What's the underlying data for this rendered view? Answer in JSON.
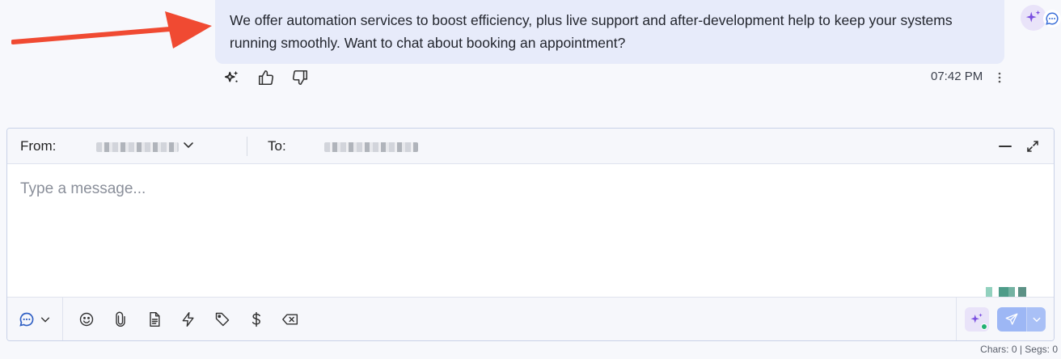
{
  "message": {
    "text": "We offer automation services to boost efficiency, plus live support and after-development help to keep your systems running smoothly. Want to chat about booking an appointment?",
    "timestamp": "07:42 PM"
  },
  "icons": {
    "arrow": "red-arrow-icon",
    "ai": "sparkle-icon",
    "like": "thumbs-up-icon",
    "dislike": "thumbs-down-icon",
    "more": "kebab-icon"
  },
  "composer": {
    "from_label": "From:",
    "to_label": "To:",
    "placeholder": "Type a message..."
  },
  "toolbar": {
    "tools": [
      "emoji-icon",
      "paperclip-icon",
      "document-icon",
      "lightning-icon",
      "tag-icon",
      "dollar-icon",
      "clear-icon"
    ]
  },
  "footer": {
    "counter": "Chars: 0 | Segs: 0"
  },
  "colors": {
    "accent": "#7a4fe0",
    "send": "#9db7f5",
    "arrow": "#f04a32",
    "bubble": "#e7ebfa"
  }
}
